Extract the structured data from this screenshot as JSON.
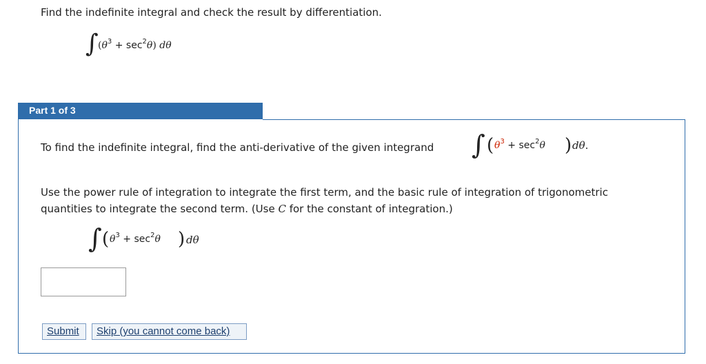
{
  "question": {
    "prompt": "Find the indefinite integral and check the result by differentiation.",
    "integral": {
      "open": "(",
      "base": "θ",
      "exp1": "3",
      "plus": " + sec",
      "exp2": "2",
      "var": "θ",
      "close": ")",
      "d": " d",
      "dvar": "θ"
    }
  },
  "part": {
    "header": "Part 1 of 3",
    "find_text": "To find the indefinite integral, find the anti-derivative of the given integrand",
    "inline_integral": {
      "base": "θ",
      "exp1": "3",
      "plus": " + sec",
      "exp2": "2",
      "var": "θ",
      "d": " d",
      "dvar": "θ",
      "end": "."
    },
    "rule_text_1": "Use the power rule of integration to integrate the first term, and the basic rule of integration of trigonometric quantities to integrate the second term. (Use ",
    "rule_c": "C",
    "rule_text_2": " for the constant of integration.)",
    "answer_integral": {
      "base": "θ",
      "exp1": "3",
      "plus": " + sec",
      "exp2": "2",
      "var": "θ",
      "d": " d",
      "dvar": "θ"
    },
    "answer_value": ""
  },
  "buttons": {
    "submit": "Submit",
    "skip": "Skip (you cannot come back)"
  },
  "colors": {
    "header_bg": "#2f6dab",
    "highlight": "#cc2200"
  }
}
